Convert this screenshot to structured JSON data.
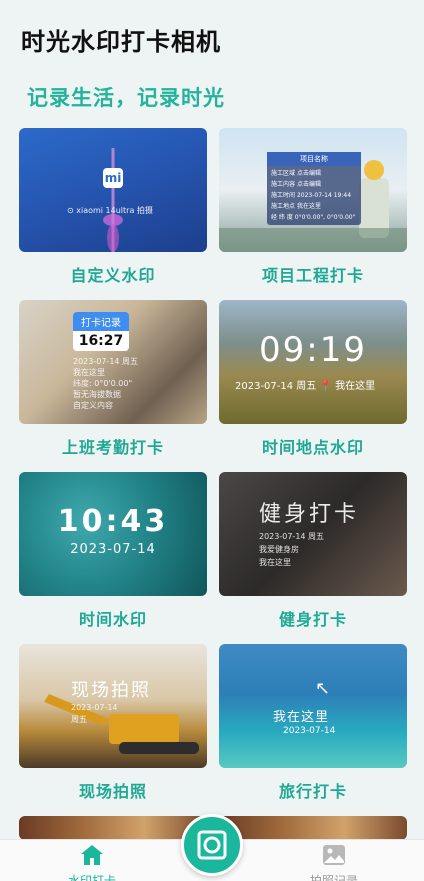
{
  "app_title": "时光水印打卡相机",
  "slogan": "记录生活，记录时光",
  "cards": [
    {
      "label": "自定义水印",
      "overlay": {
        "brand": "mi",
        "caption": "⊙ xiaomi 14ultra 拍摄"
      }
    },
    {
      "label": "项目工程打卡",
      "overlay": {
        "header": "项目名称",
        "rows": [
          {
            "k": "施工区域",
            "v": "点击编辑"
          },
          {
            "k": "施工内容",
            "v": "点击编辑"
          },
          {
            "k": "施工时间",
            "v": "2023-07-14 19:44"
          },
          {
            "k": "施工地点",
            "v": "我在这里"
          },
          {
            "k": "经 纬 度",
            "v": "0°0'0.00\", 0°0'0.00\""
          }
        ]
      }
    },
    {
      "label": "上班考勤打卡",
      "overlay": {
        "badge": "打卡记录",
        "time": "16:27",
        "lines": [
          "2023-07-14 周五",
          "我在这里",
          "纬度: 0°0'0.00\"",
          "暂无海拔数据",
          "自定义内容"
        ]
      }
    },
    {
      "label": "时间地点水印",
      "overlay": {
        "time": "09:19",
        "info": "2023-07-14 周五",
        "place": "我在这里"
      }
    },
    {
      "label": "时间水印",
      "overlay": {
        "time": "10:43",
        "date": "2023-07-14"
      }
    },
    {
      "label": "健身打卡",
      "overlay": {
        "title": "健身打卡",
        "lines": [
          "2023-07-14 周五",
          "我爱健身房",
          "我在这里"
        ]
      }
    },
    {
      "label": "现场拍照",
      "overlay": {
        "title": "现场拍照",
        "lines": [
          "2023-07-14",
          "周五"
        ]
      }
    },
    {
      "label": "旅行打卡",
      "overlay": {
        "place": "我在这里",
        "date": "2023-07-14"
      }
    }
  ],
  "bottom_nav": {
    "home_label": "水印打卡",
    "records_label": "拍照记录"
  },
  "colors": {
    "accent": "#1fa894",
    "fab": "#1ab79c"
  }
}
